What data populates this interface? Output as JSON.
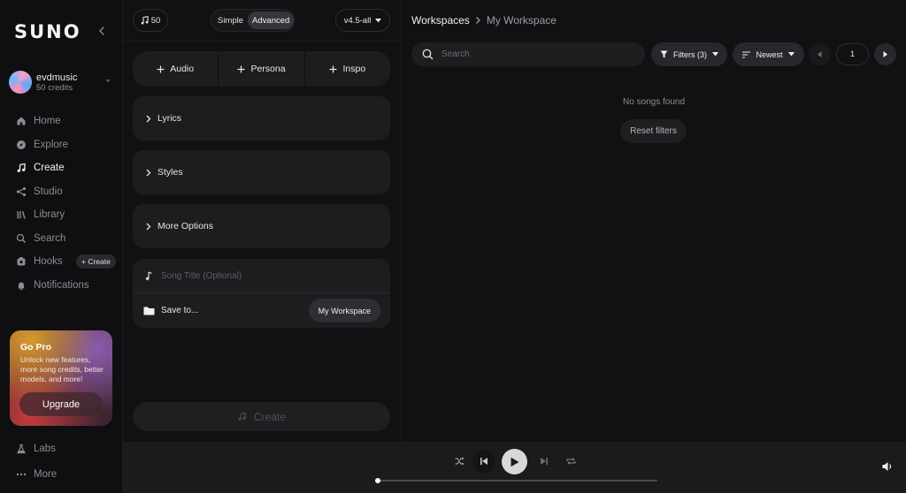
{
  "app": {
    "logo": "SUNO"
  },
  "profile": {
    "name": "evdmusic",
    "credits": "50 credits"
  },
  "nav": {
    "home": "Home",
    "explore": "Explore",
    "create": "Create",
    "studio": "Studio",
    "library": "Library",
    "search": "Search",
    "hooks": "Hooks",
    "hooks_create": "+ Create",
    "notifications": "Notifications",
    "labs": "Labs",
    "more": "More"
  },
  "promo": {
    "title": "Go Pro",
    "description": "Unlock new features, more song credits, better models, and more!",
    "button": "Upgrade"
  },
  "create_panel": {
    "credit_count": "50",
    "modes": [
      "Simple",
      "Advanced"
    ],
    "active_mode": "Advanced",
    "model": "v4.5-all",
    "add_buttons": [
      "Audio",
      "Persona",
      "Inspo"
    ],
    "sections": [
      "Lyrics",
      "Styles",
      "More Options"
    ],
    "title_placeholder": "Song Title (Optional)",
    "save_to_label": "Save to...",
    "workspace_button": "My Workspace",
    "create_button": "Create"
  },
  "workspace": {
    "breadcrumb_root": "Workspaces",
    "breadcrumb_current": "My Workspace",
    "search_placeholder": "Search",
    "filters_label": "Filters (3)",
    "sort_label": "Newest",
    "page": "1",
    "empty_message": "No songs found",
    "reset_button": "Reset filters"
  },
  "player": {
    "progress": 0
  },
  "colors": {
    "background": "#111113",
    "panel": "#1d1d20",
    "accent": "#d8d8da"
  }
}
